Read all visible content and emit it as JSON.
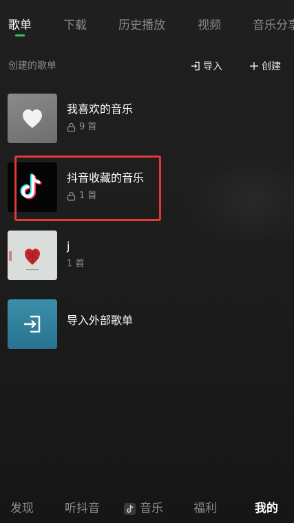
{
  "tabs": [
    {
      "label": "歌单",
      "active": true
    },
    {
      "label": "下载",
      "active": false
    },
    {
      "label": "历史播放",
      "active": false
    },
    {
      "label": "视频",
      "active": false
    },
    {
      "label": "音乐分享",
      "active": false
    }
  ],
  "section": {
    "title": "创建的歌单",
    "import_label": "导入",
    "create_label": "创建"
  },
  "playlists": [
    {
      "name": "我喜欢的音乐",
      "count": "9 首",
      "locked": true,
      "cover_icon": "heart-icon"
    },
    {
      "name": "抖音收藏的音乐",
      "count": "1 首",
      "locked": true,
      "cover_icon": "tiktok-logo"
    },
    {
      "name": "j",
      "count": "1 首",
      "locked": false,
      "cover_icon": "album-art-red-heart"
    },
    {
      "name": "导入外部歌单",
      "count": "",
      "locked": false,
      "cover_icon": "import-icon"
    }
  ],
  "bottom_nav": [
    {
      "label": "发现",
      "active": false
    },
    {
      "label": "听抖音",
      "active": false
    },
    {
      "label": "音乐",
      "active": false,
      "icon": "music-app-icon"
    },
    {
      "label": "福利",
      "active": false
    },
    {
      "label": "我的",
      "active": true
    }
  ],
  "colors": {
    "accent": "#2ec76a",
    "highlight": "#e53935",
    "background": "#1c1c1c"
  }
}
